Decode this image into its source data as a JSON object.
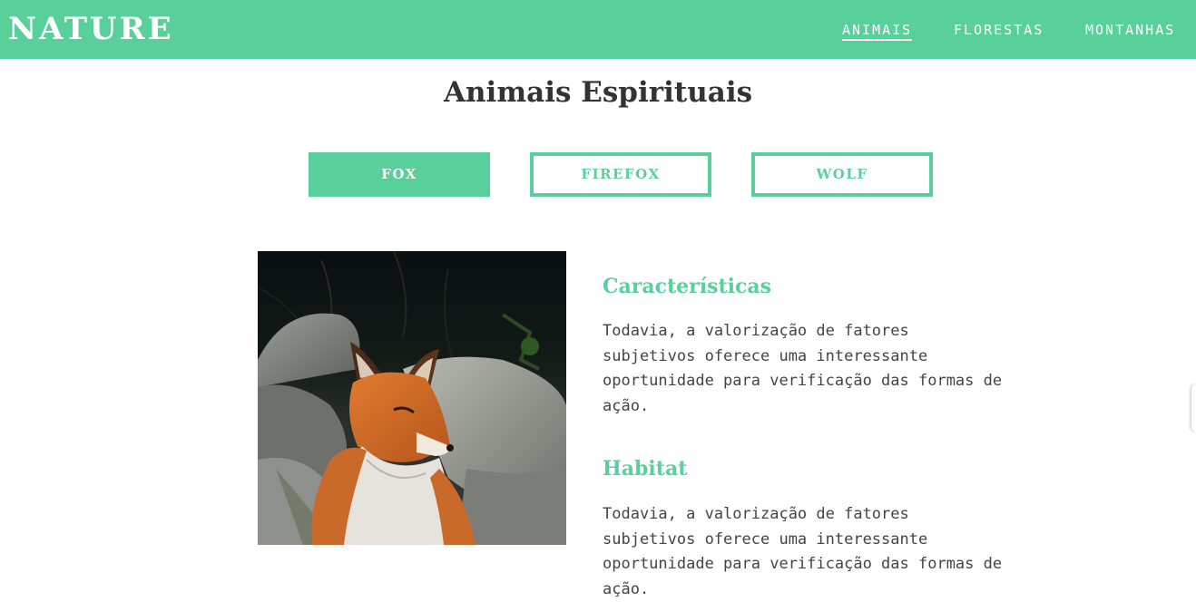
{
  "header": {
    "logo": "NATURE",
    "nav": [
      {
        "label": "ANIMAIS",
        "active": true
      },
      {
        "label": "FLORESTAS",
        "active": false
      },
      {
        "label": "MONTANHAS",
        "active": false
      }
    ]
  },
  "main": {
    "title": "Animais Espirituais",
    "tabs": [
      {
        "label": "FOX",
        "active": true
      },
      {
        "label": "FIREFOX",
        "active": false
      },
      {
        "label": "WOLF",
        "active": false
      }
    ],
    "sections": [
      {
        "heading": "Características",
        "text": "Todavia, a valorização de fatores subjetivos oferece uma interessante oportunidade para verificação das formas de ação."
      },
      {
        "heading": "Habitat",
        "text": "Todavia, a valorização de fatores subjetivos oferece uma interessante oportunidade para verificação das formas de ação."
      }
    ]
  },
  "colors": {
    "accent": "#59cf9c",
    "title_text": "#333333",
    "body_text": "#444444"
  }
}
